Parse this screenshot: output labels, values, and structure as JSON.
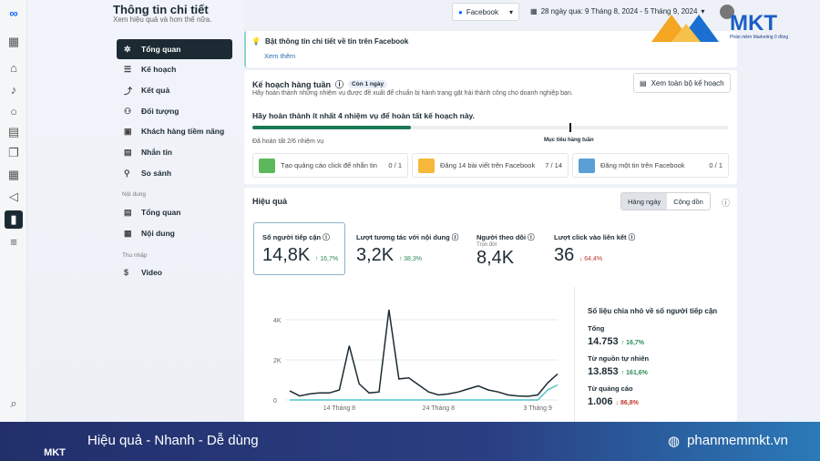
{
  "page": {
    "title": "Thông tin chi tiết",
    "subtitle": "Xem hiệu quả và hơn thế nữa."
  },
  "nav": {
    "items": [
      {
        "label": "Tổng quan",
        "icon": "sparkle-icon"
      },
      {
        "label": "Kế hoạch",
        "icon": "list-icon"
      },
      {
        "label": "Kết quả",
        "icon": "trend-icon"
      },
      {
        "label": "Đối tượng",
        "icon": "people-icon"
      },
      {
        "label": "Khách hàng tiềm năng",
        "icon": "contact-card-icon"
      },
      {
        "label": "Nhắn tin",
        "icon": "message-icon"
      },
      {
        "label": "So sánh",
        "icon": "compare-icon"
      }
    ],
    "content_section": "Nội dung",
    "content_items": [
      {
        "label": "Tổng quan"
      },
      {
        "label": "Nội dung"
      }
    ],
    "income_section": "Thu nhập",
    "income_items": [
      {
        "label": "Video"
      }
    ]
  },
  "topbar": {
    "platform": "Facebook",
    "date_range": "28 ngày qua: 9 Tháng 8, 2024 - 5 Tháng 9, 2024"
  },
  "watermark": {
    "brand": "MKT",
    "tagline": "Phần mềm Marketing 0 đồng"
  },
  "banner": {
    "title": "Bật thông tin chi tiết về tin trên Facebook",
    "link": "Xem thêm"
  },
  "plan": {
    "title": "Kế hoạch hàng tuần",
    "badge": "Còn 1 ngày",
    "description": "Hãy hoàn thành những nhiệm vụ được đề xuất để chuẩn bị hành trang gặt hái thành công cho doanh nghiệp bạn.",
    "view_all": "Xem toàn bộ kế hoạch",
    "goal_text": "Hãy hoàn thành ít nhất 4 nhiệm vụ để hoàn tất kế hoạch này.",
    "progress": 0.333,
    "weekly_goal_fraction": 0.667,
    "done_text": "Đã hoàn tất 2/6 nhiệm vụ",
    "goal_label": "Mục tiêu hàng tuần",
    "tasks": [
      {
        "label": "Tạo quảng cáo click để nhắn tin",
        "count": "0 / 1",
        "color": "#4caf50"
      },
      {
        "label": "Đăng 14 bài viết trên Facebook",
        "count": "7 / 14",
        "color": "#f5a623"
      },
      {
        "label": "Đăng một tin trên Facebook",
        "count": "0 / 1",
        "color": "#3b82c4"
      }
    ]
  },
  "performance": {
    "title": "Hiệu quả",
    "toggle": [
      "Hàng ngày",
      "Cộng dồn"
    ],
    "metrics": [
      {
        "label": "Số người tiếp cận",
        "value": "14,8K",
        "change": "↑ 16,7%",
        "dir": "up"
      },
      {
        "label": "Lượt tương tác với nội dung",
        "value": "3,2K",
        "change": "↑ 38,3%",
        "dir": "up"
      },
      {
        "label": "Người theo dõi",
        "sub": "Trọn đời",
        "value": "8,4K"
      },
      {
        "label": "Lượt click vào liên kết",
        "value": "36",
        "change": "↓ 64,4%",
        "dir": "down"
      }
    ],
    "breakdown": {
      "title": "Số liệu chia nhỏ về số người tiếp cận",
      "rows": [
        {
          "label": "Tổng",
          "value": "14.753",
          "change": "↑ 16,7%",
          "dir": "up"
        },
        {
          "label": "Từ nguồn tự nhiên",
          "value": "13.853",
          "change": "↑ 161,6%",
          "dir": "up"
        },
        {
          "label": "Từ quảng cáo",
          "value": "1.006",
          "change": "↓ 86,8%",
          "dir": "down"
        }
      ]
    }
  },
  "chart_data": {
    "type": "line",
    "x_start": "9 Tháng 8",
    "x_end": "5 Tháng 9",
    "xticks": [
      "14 Tháng 8",
      "24 Tháng 8",
      "3 Tháng 9"
    ],
    "yticks": [
      "0",
      "2K",
      "4K"
    ],
    "ylim": [
      0,
      4600
    ],
    "grid": true,
    "series": [
      {
        "color": "#1c2b33",
        "values": [
          450,
          200,
          300,
          350,
          350,
          500,
          2700,
          800,
          350,
          400,
          4500,
          1050,
          1100,
          750,
          400,
          250,
          300,
          400,
          550,
          700,
          500,
          400,
          250,
          200,
          180,
          250,
          850,
          1300
        ]
      },
      {
        "color": "#4fc3c8",
        "values": [
          0,
          0,
          0,
          0,
          0,
          0,
          0,
          0,
          0,
          0,
          0,
          0,
          0,
          0,
          0,
          0,
          0,
          0,
          0,
          0,
          0,
          0,
          0,
          0,
          0,
          0,
          500,
          750
        ]
      }
    ]
  },
  "footer": {
    "slogan": "Hiệu quả - Nhanh - Dễ dùng",
    "website": "phanmemmkt.vn",
    "logo": "MKT"
  }
}
